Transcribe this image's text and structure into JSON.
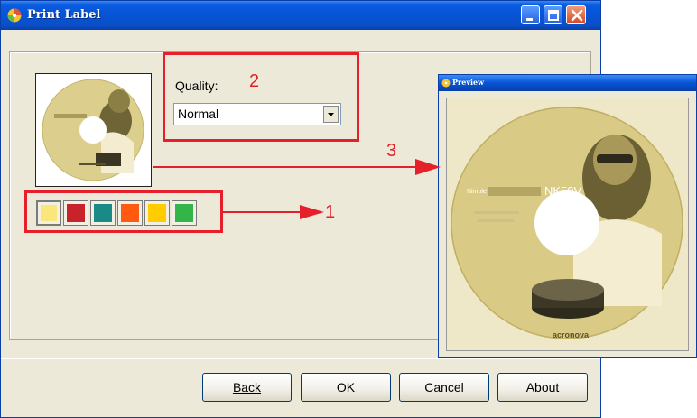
{
  "window": {
    "title": "Print Label"
  },
  "quality": {
    "label": "Quality:",
    "value": "Normal"
  },
  "swatches": [
    "#fbe67a",
    "#c8232b",
    "#1a8a87",
    "#ff5a10",
    "#ffcc00",
    "#33b54a"
  ],
  "buttons": {
    "back": "Back",
    "ok": "OK",
    "cancel": "Cancel",
    "about": "About"
  },
  "annotations": {
    "n1": "1",
    "n2": "2",
    "n3": "3",
    "color": "#e5202a"
  },
  "preview": {
    "title": "Preview"
  },
  "disc": {
    "brand_line": "Nimble",
    "model": "NK50V",
    "logo": "acronova"
  }
}
